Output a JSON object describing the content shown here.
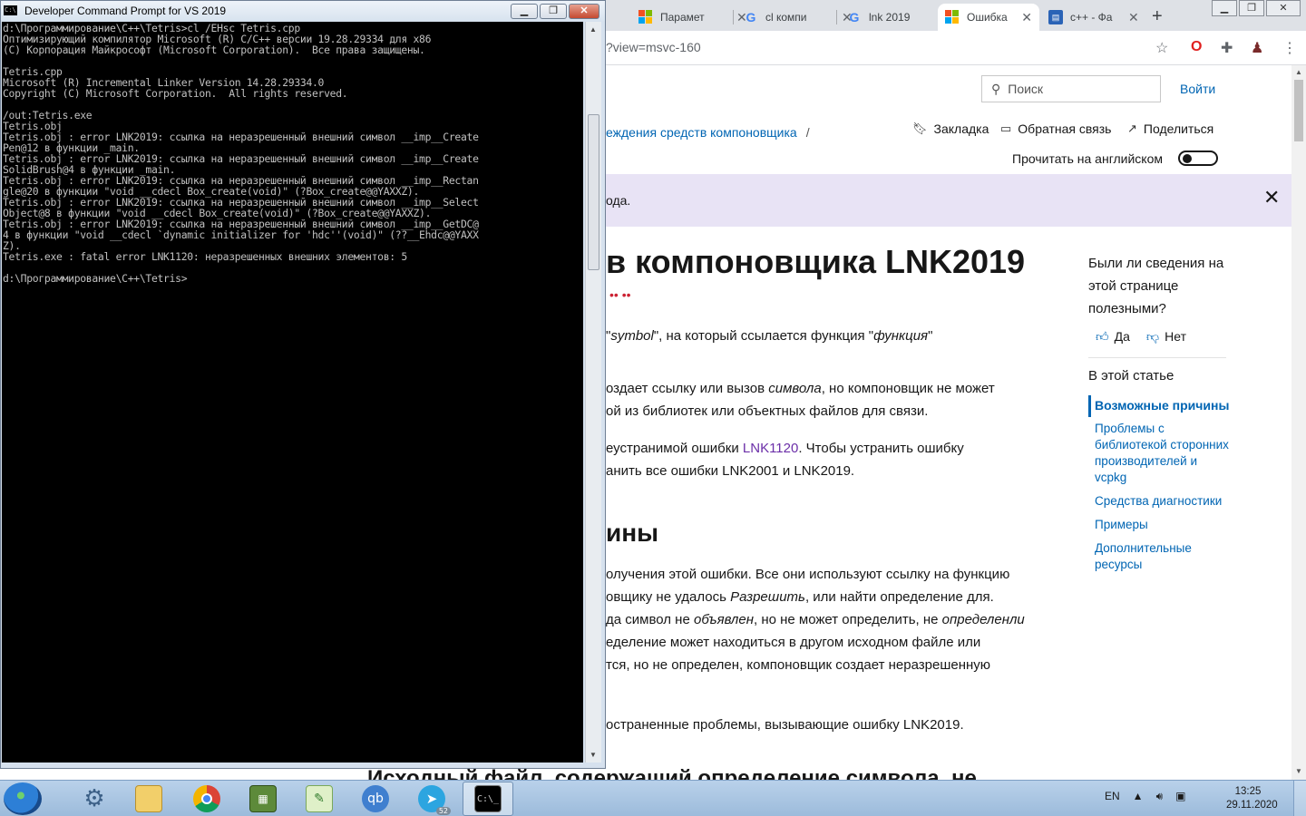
{
  "browser": {
    "tabs": [
      {
        "title": "Парамет",
        "icon": "microsoft-icon"
      },
      {
        "title": "cl компи",
        "icon": "google-icon"
      },
      {
        "title": "lnk 2019",
        "icon": "google-icon"
      },
      {
        "title": "Ошибка",
        "icon": "microsoft-icon"
      },
      {
        "title": "c++ - Фа",
        "icon": "stackoverflow-icon"
      }
    ],
    "url": "?view=msvc-160"
  },
  "page": {
    "search_placeholder": "Поиск",
    "signin": "Войти",
    "breadcrumb": "еждения средств компоновщика",
    "breadcrumb_sep": "/",
    "actions": {
      "bookmark": "Закладка",
      "feedback": "Обратная связь",
      "share": "Поделиться"
    },
    "read_english": "Прочитать на английском",
    "banner_text": "ода.",
    "title": "в компоновщика LNK2019",
    "contributors": "•• ••",
    "paragraphs": {
      "p1a": "\"",
      "p1_symbol": "symbol",
      "p1b": "\", на который ссылается функция \"",
      "p1_function": "функция",
      "p1c": "\"",
      "p2_line1a": "оздает ссылку или вызов ",
      "p2_symbol": "символа",
      "p2_line1b": ", но компоновщик не может",
      "p2_line2": "ой из библиотек или объектных файлов для связи.",
      "p3_line1a": "еустранимой ошибки ",
      "p3_link": "LNK1120",
      "p3_line1b": ". Чтобы устранить ошибку",
      "p3_line2": "анить все ошибки LNK2001 и LNK2019.",
      "h2": "ины",
      "p4_line1": "олучения этой ошибки. Все они используют ссылку на функцию",
      "p4_line2a": "овщику не удалось ",
      "p4_resolve": "Разрешить",
      "p4_line2b": ", или найти определение для.",
      "p4_line3a": "да символ не ",
      "p4_declared": "объявлен",
      "p4_line3b": ", но не может определить, не ",
      "p4_defined": "определенли",
      "p4_line4": "еделение может находиться в другом исходном файле или",
      "p4_line5": "тся, но не определен, компоновщик создает неразрешенную",
      "p5": "остраненные проблемы, вызывающие ошибку LNK2019.",
      "h3": "Исходный файл, содержащий определение символа, не"
    },
    "sidebar": {
      "question": "Были ли сведения на этой странице полезными?",
      "yes": "Да",
      "no": "Нет",
      "toc_title": "В этой статье",
      "toc": [
        "Возможные причины",
        "Проблемы с библиотекой сторонних производителей и vcpkg",
        "Средства диагностики",
        "Примеры",
        "Дополнительные ресурсы"
      ]
    }
  },
  "console": {
    "title": "Developer Command Prompt for VS 2019",
    "lines": [
      "d:\\Программирование\\C++\\Tetris>cl /EHsc Tetris.cpp",
      "Оптимизирующий компилятор Microsoft (R) C/C++ версии 19.28.29334 для x86",
      "(C) Корпорация Майкрософт (Microsoft Corporation).  Все права защищены.",
      "",
      "Tetris.cpp",
      "Microsoft (R) Incremental Linker Version 14.28.29334.0",
      "Copyright (C) Microsoft Corporation.  All rights reserved.",
      "",
      "/out:Tetris.exe",
      "Tetris.obj",
      "Tetris.obj : error LNK2019: ссылка на неразрешенный внешний символ __imp__Create",
      "Pen@12 в функции _main.",
      "Tetris.obj : error LNK2019: ссылка на неразрешенный внешний символ __imp__Create",
      "SolidBrush@4 в функции _main.",
      "Tetris.obj : error LNK2019: ссылка на неразрешенный внешний символ __imp__Rectan",
      "gle@20 в функции \"void __cdecl Box_create(void)\" (?Box_create@@YAXXZ).",
      "Tetris.obj : error LNK2019: ссылка на неразрешенный внешний символ __imp__Select",
      "Object@8 в функции \"void __cdecl Box_create(void)\" (?Box_create@@YAXXZ).",
      "Tetris.obj : error LNK2019: ссылка на неразрешенный внешний символ __imp__GetDC@",
      "4 в функции \"void __cdecl `dynamic initializer for 'hdc''(void)\" (??__Ehdc@@YAXX",
      "Z).",
      "Tetris.exe : fatal error LNK1120: неразрешенных внешних элементов: 5",
      "",
      "d:\\Программирование\\C++\\Tetris>"
    ]
  },
  "taskbar": {
    "apps": [
      "settings",
      "explorer",
      "chrome",
      "task-manager",
      "notepad-plus-plus",
      "qbittorrent",
      "telegram",
      "command-prompt"
    ],
    "telegram_badge": "52",
    "lang": "EN",
    "time": "13:25",
    "date": "29.11.2020"
  }
}
